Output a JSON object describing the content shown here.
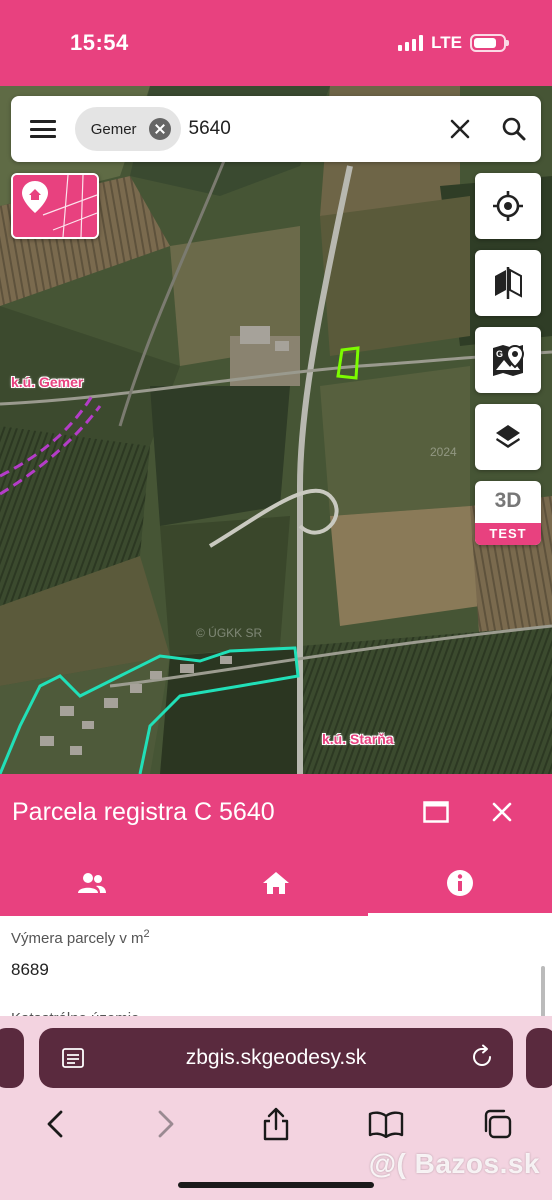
{
  "status_bar": {
    "time": "15:54",
    "network": "LTE",
    "signal_bars": 4,
    "battery_level": 0.8
  },
  "search": {
    "chip_label": "Gemer",
    "value": "5640",
    "menu_icon": "hamburger-icon",
    "clear_icon": "close-icon",
    "search_icon": "search-icon"
  },
  "map": {
    "labels": {
      "gemer": "k.ú. Gemer",
      "starna": "k.ú. Starňa"
    },
    "watermark_year": "2024",
    "watermark_source": "© ÚGKK SR"
  },
  "map_buttons": {
    "locate_icon": "crosshair-icon",
    "compare_icon": "split-view-icon",
    "gmaps_icon": "google-maps-icon",
    "layers_icon": "layers-icon",
    "three_d_label": "3D",
    "three_d_badge": "TEST"
  },
  "panel": {
    "title": "Parcela registra C 5640",
    "maximize_icon": "maximize-icon",
    "close_icon": "close-icon",
    "tabs": [
      "owners-icon",
      "home-icon",
      "info-icon"
    ],
    "active_tab": 2,
    "field_label": "Výmera parcely v m",
    "field_label_sup": "2",
    "field_value": "8689",
    "next_field_label": "Katastrálne územie"
  },
  "browser": {
    "url": "zbgis.skgeodesy.sk",
    "reader_icon": "reader-icon",
    "reload_icon": "reload-icon",
    "toolbar": [
      "back-icon",
      "forward-icon",
      "share-icon",
      "bookmarks-icon",
      "tabs-icon"
    ]
  },
  "watermark": "@( Bazos.sk",
  "colors": {
    "accent": "#e8417f",
    "browser_bar": "#5a2a3e",
    "browser_bg": "#f3d3e0",
    "parcel_highlight": "#7cfc00",
    "boundary_cyan": "#21e0b8",
    "boundary_purple": "#b43cc8"
  }
}
